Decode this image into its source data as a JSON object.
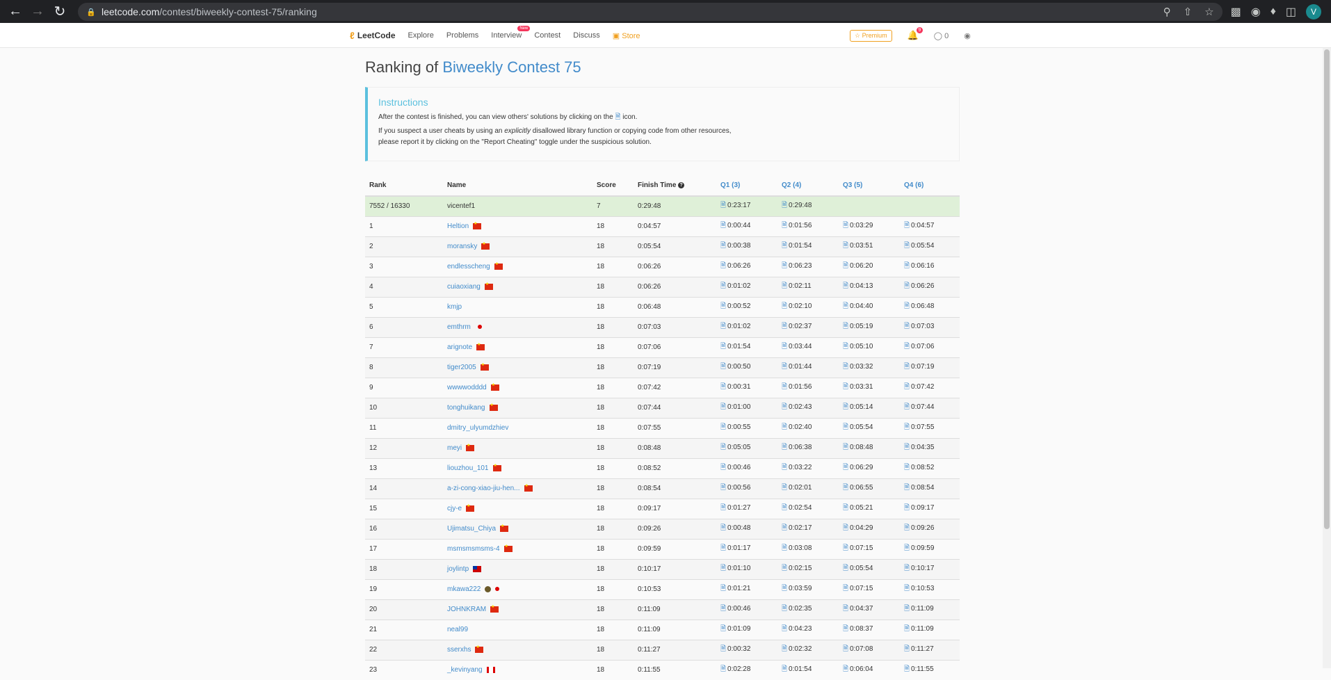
{
  "browser": {
    "url_host": "leetcode.com",
    "url_path": "/contest/biweekly-contest-75/ranking",
    "profile_initial": "V"
  },
  "nav": {
    "logo_text": "LeetCode",
    "items": [
      "Explore",
      "Problems",
      "Interview",
      "Contest",
      "Discuss"
    ],
    "new_badge": "New",
    "store": "Store",
    "premium": "Premium",
    "notification_count": "9",
    "coins": "0"
  },
  "page": {
    "title_prefix": "Ranking of",
    "contest_name": "Biweekly Contest 75"
  },
  "instructions": {
    "heading": "Instructions",
    "line1_a": "After the contest is finished, you can view others' solutions by clicking on the",
    "line1_b": "icon.",
    "line2_a": "If you suspect a user cheats by using an",
    "line2_em": "explicitly",
    "line2_b": "disallowed library function or copying code from other resources,",
    "line3": "please report it by clicking on the \"Report Cheating\" toggle under the suspicious solution."
  },
  "table": {
    "headers": {
      "rank": "Rank",
      "name": "Name",
      "score": "Score",
      "finish": "Finish Time",
      "q1": "Q1 (3)",
      "q2": "Q2 (4)",
      "q3": "Q3 (5)",
      "q4": "Q4 (6)"
    },
    "self": {
      "rank": "7552 / 16330",
      "name": "vicentef1",
      "score": "7",
      "finish": "0:29:48",
      "q1": "0:23:17",
      "q2": "0:29:48",
      "q3": "",
      "q4": ""
    },
    "rows": [
      {
        "rank": "1",
        "name": "Heltion",
        "flag": "cn",
        "score": "18",
        "finish": "0:04:57",
        "q1": "0:00:44",
        "q2": "0:01:56",
        "q3": "0:03:29",
        "q4": "0:04:57"
      },
      {
        "rank": "2",
        "name": "moransky",
        "flag": "cn",
        "score": "18",
        "finish": "0:05:54",
        "q1": "0:00:38",
        "q2": "0:01:54",
        "q3": "0:03:51",
        "q4": "0:05:54"
      },
      {
        "rank": "3",
        "name": "endlesscheng",
        "flag": "cn",
        "score": "18",
        "finish": "0:06:26",
        "q1": "0:06:26",
        "q2": "0:06:23",
        "q3": "0:06:20",
        "q4": "0:06:16"
      },
      {
        "rank": "4",
        "name": "cuiaoxiang",
        "flag": "cn",
        "score": "18",
        "finish": "0:06:26",
        "q1": "0:01:02",
        "q2": "0:02:11",
        "q3": "0:04:13",
        "q4": "0:06:26"
      },
      {
        "rank": "5",
        "name": "kmjp",
        "flag": "",
        "score": "18",
        "finish": "0:06:48",
        "q1": "0:00:52",
        "q2": "0:02:10",
        "q3": "0:04:40",
        "q4": "0:06:48"
      },
      {
        "rank": "6",
        "name": "emthrm",
        "flag": "jp",
        "score": "18",
        "finish": "0:07:03",
        "q1": "0:01:02",
        "q2": "0:02:37",
        "q3": "0:05:19",
        "q4": "0:07:03"
      },
      {
        "rank": "7",
        "name": "arignote",
        "flag": "cn",
        "score": "18",
        "finish": "0:07:06",
        "q1": "0:01:54",
        "q2": "0:03:44",
        "q3": "0:05:10",
        "q4": "0:07:06"
      },
      {
        "rank": "8",
        "name": "tiger2005",
        "flag": "cn",
        "score": "18",
        "finish": "0:07:19",
        "q1": "0:00:50",
        "q2": "0:01:44",
        "q3": "0:03:32",
        "q4": "0:07:19"
      },
      {
        "rank": "9",
        "name": "wwwwodddd",
        "flag": "cn",
        "score": "18",
        "finish": "0:07:42",
        "q1": "0:00:31",
        "q2": "0:01:56",
        "q3": "0:03:31",
        "q4": "0:07:42"
      },
      {
        "rank": "10",
        "name": "tonghuikang",
        "flag": "cn",
        "score": "18",
        "finish": "0:07:44",
        "q1": "0:01:00",
        "q2": "0:02:43",
        "q3": "0:05:14",
        "q4": "0:07:44"
      },
      {
        "rank": "11",
        "name": "dmitry_ulyumdzhiev",
        "flag": "",
        "score": "18",
        "finish": "0:07:55",
        "q1": "0:00:55",
        "q2": "0:02:40",
        "q3": "0:05:54",
        "q4": "0:07:55"
      },
      {
        "rank": "12",
        "name": "meyi",
        "flag": "cn",
        "score": "18",
        "finish": "0:08:48",
        "q1": "0:05:05",
        "q2": "0:06:38",
        "q3": "0:08:48",
        "q4": "0:04:35"
      },
      {
        "rank": "13",
        "name": "liouzhou_101",
        "flag": "cn",
        "score": "18",
        "finish": "0:08:52",
        "q1": "0:00:46",
        "q2": "0:03:22",
        "q3": "0:06:29",
        "q4": "0:08:52"
      },
      {
        "rank": "14",
        "name": "a-zi-cong-xiao-jiu-hen...",
        "flag": "cn",
        "score": "18",
        "finish": "0:08:54",
        "q1": "0:00:56",
        "q2": "0:02:01",
        "q3": "0:06:55",
        "q4": "0:08:54"
      },
      {
        "rank": "15",
        "name": "cjy-e",
        "flag": "cn",
        "score": "18",
        "finish": "0:09:17",
        "q1": "0:01:27",
        "q2": "0:02:54",
        "q3": "0:05:21",
        "q4": "0:09:17"
      },
      {
        "rank": "16",
        "name": "Ujimatsu_Chiya",
        "flag": "cn",
        "score": "18",
        "finish": "0:09:26",
        "q1": "0:00:48",
        "q2": "0:02:17",
        "q3": "0:04:29",
        "q4": "0:09:26"
      },
      {
        "rank": "17",
        "name": "msmsmsmsms-4",
        "flag": "cn",
        "score": "18",
        "finish": "0:09:59",
        "q1": "0:01:17",
        "q2": "0:03:08",
        "q3": "0:07:15",
        "q4": "0:09:59"
      },
      {
        "rank": "18",
        "name": "joylintp",
        "flag": "tw",
        "score": "18",
        "finish": "0:10:17",
        "q1": "0:01:10",
        "q2": "0:02:15",
        "q3": "0:05:54",
        "q4": "0:10:17"
      },
      {
        "rank": "19",
        "name": "mkawa222",
        "flag": "emoji-jp",
        "score": "18",
        "finish": "0:10:53",
        "q1": "0:01:21",
        "q2": "0:03:59",
        "q3": "0:07:15",
        "q4": "0:10:53"
      },
      {
        "rank": "20",
        "name": "JOHNKRAM",
        "flag": "cn",
        "score": "18",
        "finish": "0:11:09",
        "q1": "0:00:46",
        "q2": "0:02:35",
        "q3": "0:04:37",
        "q4": "0:11:09"
      },
      {
        "rank": "21",
        "name": "neal99",
        "flag": "",
        "score": "18",
        "finish": "0:11:09",
        "q1": "0:01:09",
        "q2": "0:04:23",
        "q3": "0:08:37",
        "q4": "0:11:09"
      },
      {
        "rank": "22",
        "name": "sserxhs",
        "flag": "cn",
        "score": "18",
        "finish": "0:11:27",
        "q1": "0:00:32",
        "q2": "0:02:32",
        "q3": "0:07:08",
        "q4": "0:11:27"
      },
      {
        "rank": "23",
        "name": "_kevinyang",
        "flag": "ca",
        "score": "18",
        "finish": "0:11:55",
        "q1": "0:02:28",
        "q2": "0:01:54",
        "q3": "0:06:04",
        "q4": "0:11:55"
      }
    ]
  }
}
